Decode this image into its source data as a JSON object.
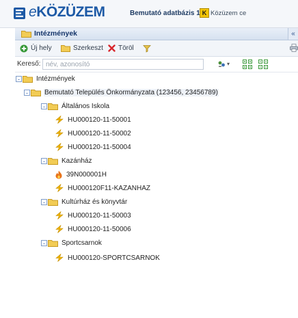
{
  "header": {
    "logo_prefix": "e",
    "logo_main": "KÖZÜZEM",
    "database_select": "Bemutató adatbázis 1",
    "dropdown_caret": "▾",
    "k_badge": "K",
    "kozuzem_link": "Közüzem ce"
  },
  "panel": {
    "title": "Intézmények",
    "collapse_glyph": "«"
  },
  "toolbar": {
    "new_label": "Új hely",
    "edit_label": "Szerkeszt",
    "delete_label": "Töröl"
  },
  "search": {
    "label": "Kereső:",
    "placeholder": "név, azonosító",
    "options_caret": "▾"
  },
  "tree": {
    "root": "Intézmények",
    "org": "Bemutató Település Önkormányzata (123456, 23456789)",
    "toggle_expanded": "-",
    "groups": [
      {
        "name": "Általános Iskola",
        "items": [
          "HU000120-11-50001",
          "HU000120-11-50002",
          "HU000120-11-50004"
        ]
      },
      {
        "name": "Kazánház",
        "items": [
          "39N000001H",
          "HU000120F11-KAZANHAZ"
        ]
      },
      {
        "name": "Kultúrház és könyvtár",
        "items": [
          "HU000120-11-50003",
          "HU000120-11-50006"
        ]
      },
      {
        "name": "Sportcsarnok",
        "items": [
          "HU000120-SPORTCSARNOK"
        ]
      }
    ]
  },
  "colors": {
    "brand_blue": "#1d5aa6",
    "electricity_icon": "#f0b400",
    "gas_icon": "#e8731a",
    "delete_icon": "#d8262c",
    "add_icon": "#3a9a3a"
  },
  "icons": {
    "electricity": "lightning-bolt-icon",
    "gas": "flame-icon",
    "folder": "folder-icon"
  }
}
